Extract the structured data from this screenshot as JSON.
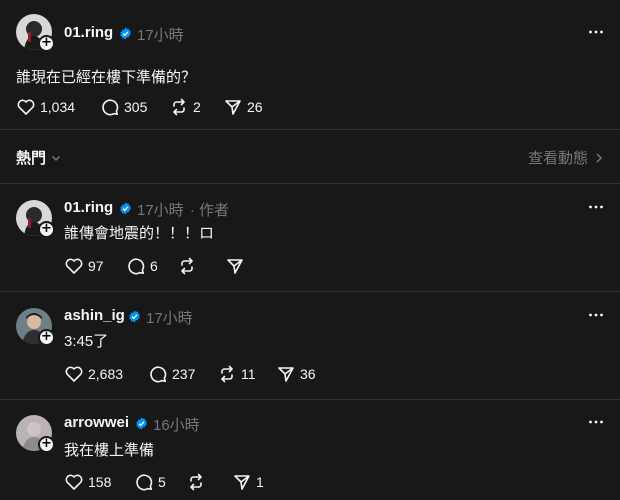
{
  "main_post": {
    "username": "01.ring",
    "time": "17小時",
    "text": "誰現在已經在樓下準備的？",
    "likes": "1,034",
    "comments": "305",
    "reposts": "2",
    "shares": "26"
  },
  "sort": {
    "label": "熱門",
    "activity_link": "查看動態"
  },
  "replies": [
    {
      "username": "01.ring",
      "time": "17小時",
      "author_tag": "· 作者",
      "text": "誰傳會地震的！！！ロ",
      "likes": "97",
      "comments": "6",
      "reposts": "",
      "shares": ""
    },
    {
      "username": "ashin_ig",
      "time": "17小時",
      "text": "3:45了",
      "likes": "2,683",
      "comments": "237",
      "reposts": "11",
      "shares": "36"
    },
    {
      "username": "arrowwei",
      "time": "16小時",
      "text": "我在樓上準備",
      "likes": "158",
      "comments": "5",
      "reposts": "",
      "shares": "1"
    }
  ],
  "colors": {
    "background": "#181818",
    "text": "#f3f5f7",
    "secondary": "#777777",
    "verified": "#0095f6",
    "divider": "#323232"
  },
  "icons": [
    "heart-icon",
    "comment-icon",
    "repost-icon",
    "share-icon",
    "more-icon",
    "verified-icon",
    "chevron-down-icon",
    "chevron-right-icon",
    "follow-plus-icon"
  ]
}
